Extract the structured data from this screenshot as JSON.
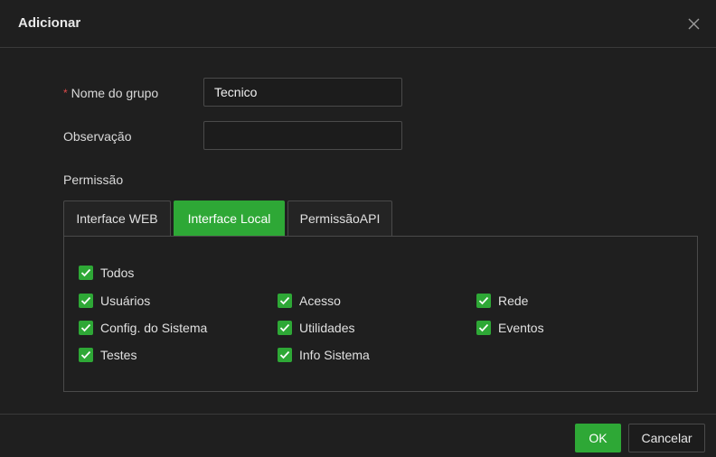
{
  "dialog": {
    "title": "Adicionar",
    "close_icon": "close-icon"
  },
  "form": {
    "required_mark": "*",
    "group_name_label": "Nome do grupo",
    "group_name_value": "Tecnico",
    "observation_label": "Observação",
    "observation_value": "",
    "permission_label": "Permissão"
  },
  "tabs": [
    {
      "label": "Interface WEB",
      "active": false
    },
    {
      "label": "Interface Local",
      "active": true
    },
    {
      "label": "PermissãoAPI",
      "active": false
    }
  ],
  "permissions": {
    "all": {
      "label": "Todos",
      "checked": true
    },
    "items": [
      {
        "label": "Usuários",
        "checked": true
      },
      {
        "label": "Acesso",
        "checked": true
      },
      {
        "label": "Rede",
        "checked": true
      },
      {
        "label": "Config. do Sistema",
        "checked": true
      },
      {
        "label": "Utilidades",
        "checked": true
      },
      {
        "label": "Eventos",
        "checked": true
      },
      {
        "label": "Testes",
        "checked": true
      },
      {
        "label": "Info Sistema",
        "checked": true
      }
    ]
  },
  "footer": {
    "ok_label": "OK",
    "cancel_label": "Cancelar"
  },
  "colors": {
    "accent": "#2ea836",
    "background": "#1f1f1f",
    "border": "#4a4a4a",
    "required": "#e04b4b"
  }
}
